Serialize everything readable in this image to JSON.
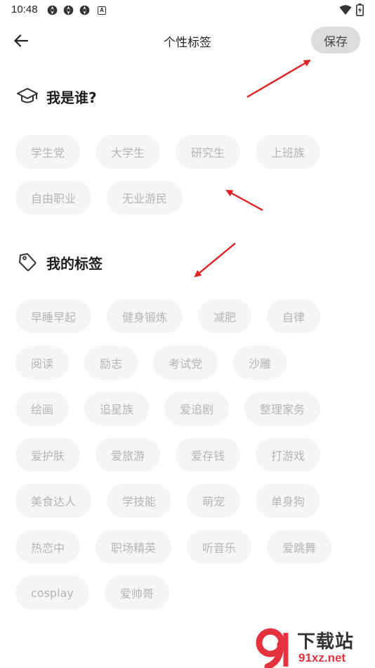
{
  "status_bar": {
    "time": "10:48",
    "notification_icons": [
      "aperture-icon",
      "aperture-icon",
      "aperture-icon",
      "a-icon"
    ],
    "a_label": "A",
    "right_icons": [
      "wifi-icon",
      "battery-icon"
    ]
  },
  "header": {
    "title": "个性标签",
    "save_label": "保存"
  },
  "sections": {
    "who": {
      "title": "我是谁?",
      "icon": "graduation-cap-icon",
      "tags": [
        "学生党",
        "大学生",
        "研究生",
        "上班族",
        "自由职业",
        "无业游民"
      ]
    },
    "mine": {
      "title": "我的标签",
      "icon": "tag-icon",
      "tags": [
        "早睡早起",
        "健身锻炼",
        "减肥",
        "自律",
        "阅读",
        "励志",
        "考试党",
        "沙雕",
        "绘画",
        "追星族",
        "爱追剧",
        "整理家务",
        "爱护肤",
        "爱旅游",
        "爱存钱",
        "打游戏",
        "美食达人",
        "学技能",
        "萌宠",
        "单身狗",
        "热恋中",
        "职场精英",
        "听音乐",
        "爱跳舞",
        "cosplay",
        "爱帅哥"
      ]
    }
  },
  "watermark": {
    "top_text": "下载站",
    "bottom_text": "91xz.net",
    "logo_color": "#e5323f"
  },
  "colors": {
    "chip_bg": "#f5f5f5",
    "chip_text": "#b5b5b5",
    "save_bg": "#dcdcdc",
    "annotation_arrow": "#e02020"
  }
}
